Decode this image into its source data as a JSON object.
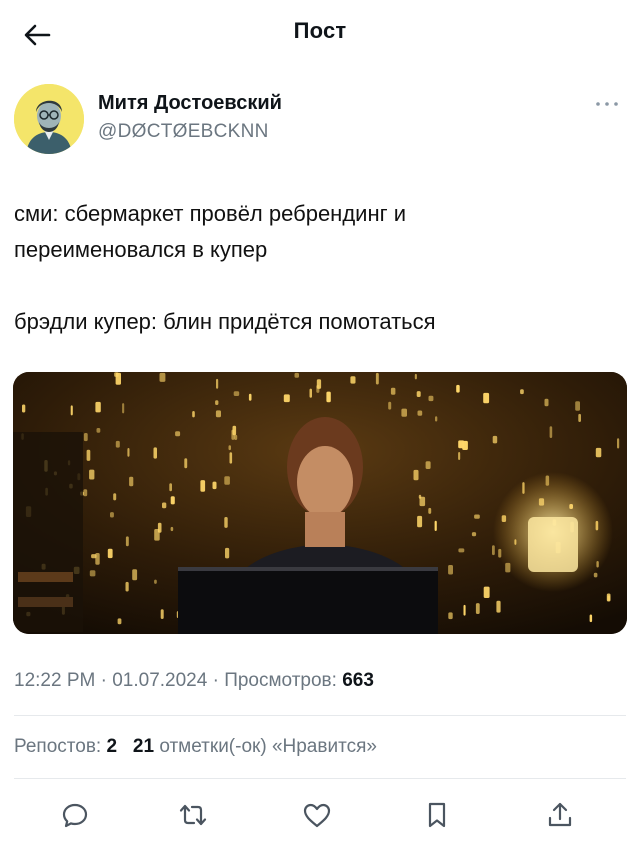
{
  "header": {
    "title": "Пост",
    "back_icon": "arrow-left-icon"
  },
  "author": {
    "name": "Митя Достоевский",
    "handle": "@DØCTØEBCKNN",
    "avatar_bg": "#f4e56a"
  },
  "tweet": {
    "lines": [
      "сми: сбермаркет провёл ребрендинг и",
      "переименовался в купер",
      "брэдли купер: блин придётся помотаться"
    ]
  },
  "meta": {
    "time": "12:22 PM",
    "date": "01.07.2024",
    "views_label": "Просмотров:",
    "views_count": "663"
  },
  "stats": {
    "reposts_label": "Репостов:",
    "reposts_count": "2",
    "likes_count": "21",
    "likes_label": "отметки(-ок) «Нравится»"
  },
  "actions": {
    "icons": [
      "reply-icon",
      "retweet-icon",
      "like-icon",
      "bookmark-icon",
      "share-icon"
    ]
  },
  "colors": {
    "text": "#0f1419",
    "muted": "#6b7680",
    "divider": "#e6e9ec"
  }
}
